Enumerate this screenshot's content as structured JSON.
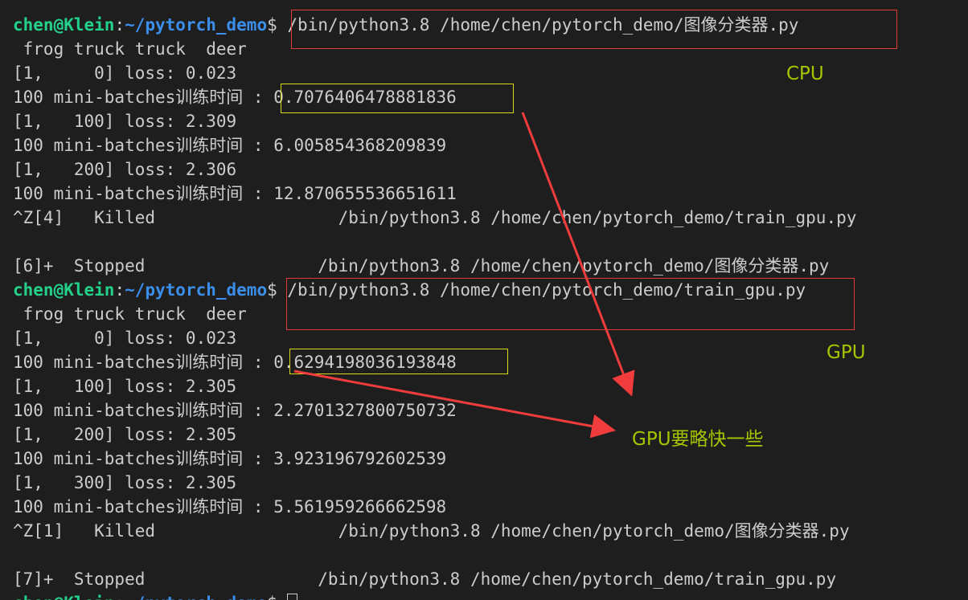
{
  "terminal": {
    "lines": [
      {
        "type": "prompt",
        "user": "chen@Klein",
        "sep": ":",
        "path": "~/pytorch_demo",
        "dollar": "$",
        "cmd": " /bin/python3.8 /home/chen/pytorch_demo/图像分类器.py"
      },
      {
        "type": "text",
        "text": " frog truck truck  deer"
      },
      {
        "type": "text",
        "text": "[1,     0] loss: 0.023"
      },
      {
        "type": "text",
        "text": "100 mini-batches训练时间 : 0.7076406478881836"
      },
      {
        "type": "text",
        "text": "[1,   100] loss: 2.309"
      },
      {
        "type": "text",
        "text": "100 mini-batches训练时间 : 6.005854368209839"
      },
      {
        "type": "text",
        "text": "[1,   200] loss: 2.306"
      },
      {
        "type": "text",
        "text": "100 mini-batches训练时间 : 12.870655536651611"
      },
      {
        "type": "text",
        "text": "^Z[4]   Killed                  /bin/python3.8 /home/chen/pytorch_demo/train_gpu.py"
      },
      {
        "type": "text",
        "text": ""
      },
      {
        "type": "text",
        "text": "[6]+  Stopped                 /bin/python3.8 /home/chen/pytorch_demo/图像分类器.py"
      },
      {
        "type": "prompt",
        "user": "chen@Klein",
        "sep": ":",
        "path": "~/pytorch_demo",
        "dollar": "$",
        "cmd": " /bin/python3.8 /home/chen/pytorch_demo/train_gpu.py"
      },
      {
        "type": "text",
        "text": " frog truck truck  deer"
      },
      {
        "type": "text",
        "text": "[1,     0] loss: 0.023"
      },
      {
        "type": "text",
        "text": "100 mini-batches训练时间 : 0.6294198036193848"
      },
      {
        "type": "text",
        "text": "[1,   100] loss: 2.305"
      },
      {
        "type": "text",
        "text": "100 mini-batches训练时间 : 2.2701327800750732"
      },
      {
        "type": "text",
        "text": "[1,   200] loss: 2.305"
      },
      {
        "type": "text",
        "text": "100 mini-batches训练时间 : 3.923196792602539"
      },
      {
        "type": "text",
        "text": "[1,   300] loss: 2.305"
      },
      {
        "type": "text",
        "text": "100 mini-batches训练时间 : 5.561959266662598"
      },
      {
        "type": "text",
        "text": "^Z[1]   Killed                  /bin/python3.8 /home/chen/pytorch_demo/图像分类器.py"
      },
      {
        "type": "text",
        "text": ""
      },
      {
        "type": "text",
        "text": "[7]+  Stopped                 /bin/python3.8 /home/chen/pytorch_demo/train_gpu.py"
      },
      {
        "type": "prompt",
        "user": "chen@Klein",
        "sep": ":",
        "path": "~/pytorch_demo",
        "dollar": "$",
        "cmd": " ",
        "cursor": true
      }
    ]
  },
  "annotations": {
    "cpu_label": "CPU",
    "gpu_label": "GPU",
    "conclusion": "GPU要略快一些"
  },
  "colors": {
    "background": "#1e1e1e",
    "text": "#cccccc",
    "prompt_user": "#23d18b",
    "prompt_path": "#3b8eea",
    "annotation_text": "#a8c400",
    "red_box": "#e03b3b",
    "yellow_box": "#d9d919",
    "arrow": "#f03c3c"
  }
}
